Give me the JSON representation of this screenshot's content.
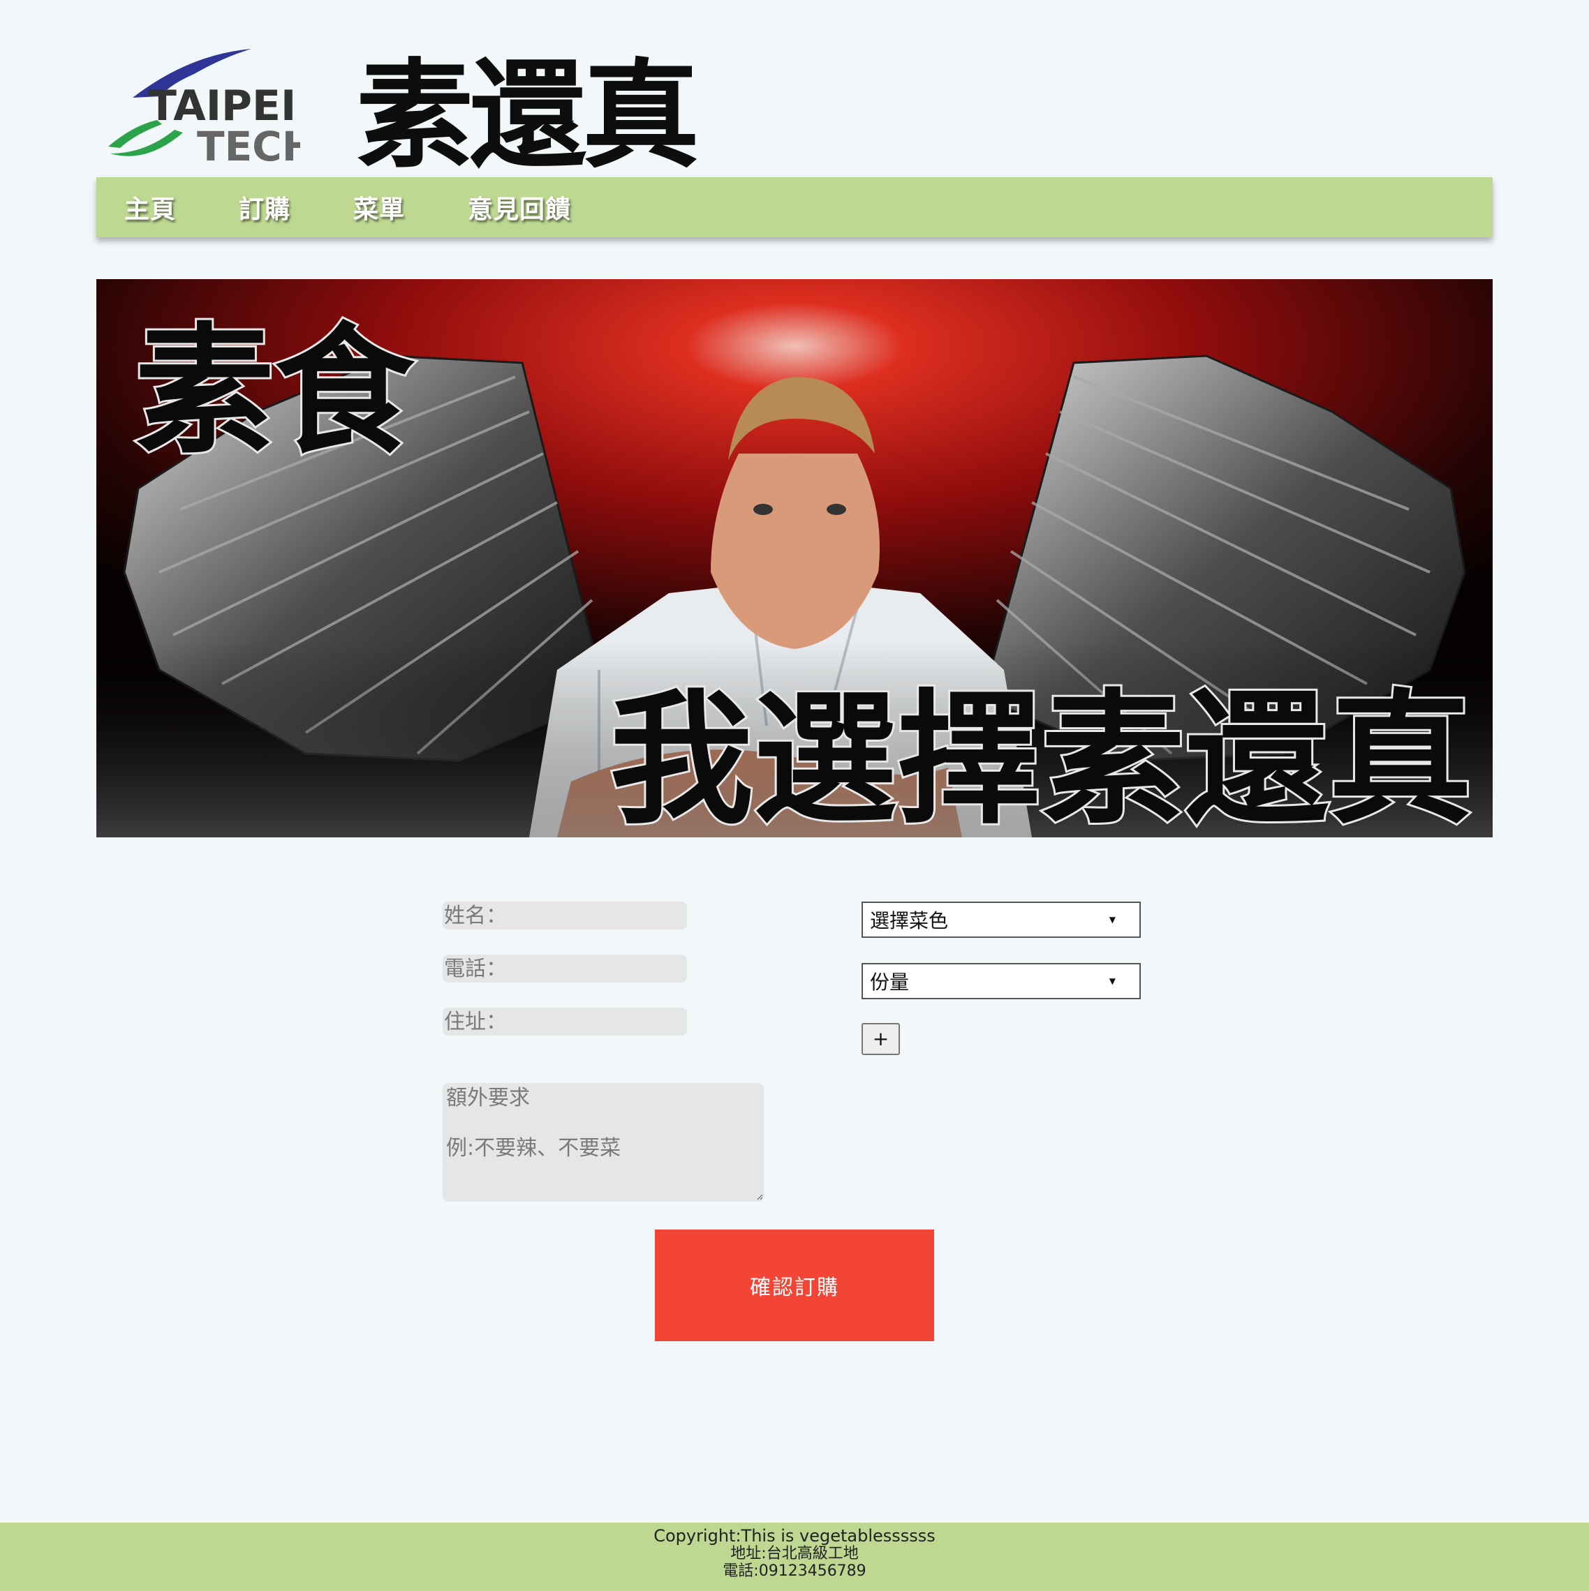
{
  "header": {
    "logo_line1": "TAIPEI",
    "logo_line2": "TECH",
    "brand_title": "素還真"
  },
  "nav": {
    "items": [
      {
        "label": "主頁"
      },
      {
        "label": "訂購"
      },
      {
        "label": "菜單"
      },
      {
        "label": "意見回饋"
      }
    ]
  },
  "banner": {
    "caption_top": "素食",
    "caption_bottom": "我選擇素還真"
  },
  "form": {
    "name_placeholder": "姓名：",
    "phone_placeholder": "電話：",
    "address_placeholder": "住址：",
    "extra_placeholder": "額外要求\n\n例:不要辣、不要菜",
    "dish_select": "選擇菜色",
    "portion_select": "份量",
    "add_button": "+",
    "submit_button": "確認訂購"
  },
  "footer": {
    "copyright": "Copyright:This is vegetablessssss",
    "address": "地址:台北高級工地",
    "phone": "電話:09123456789"
  },
  "colors": {
    "page_bg": "#f2f7f9",
    "nav_bg": "#bed891",
    "submit_bg": "#f34536",
    "input_bg": "#e6e6e6"
  }
}
